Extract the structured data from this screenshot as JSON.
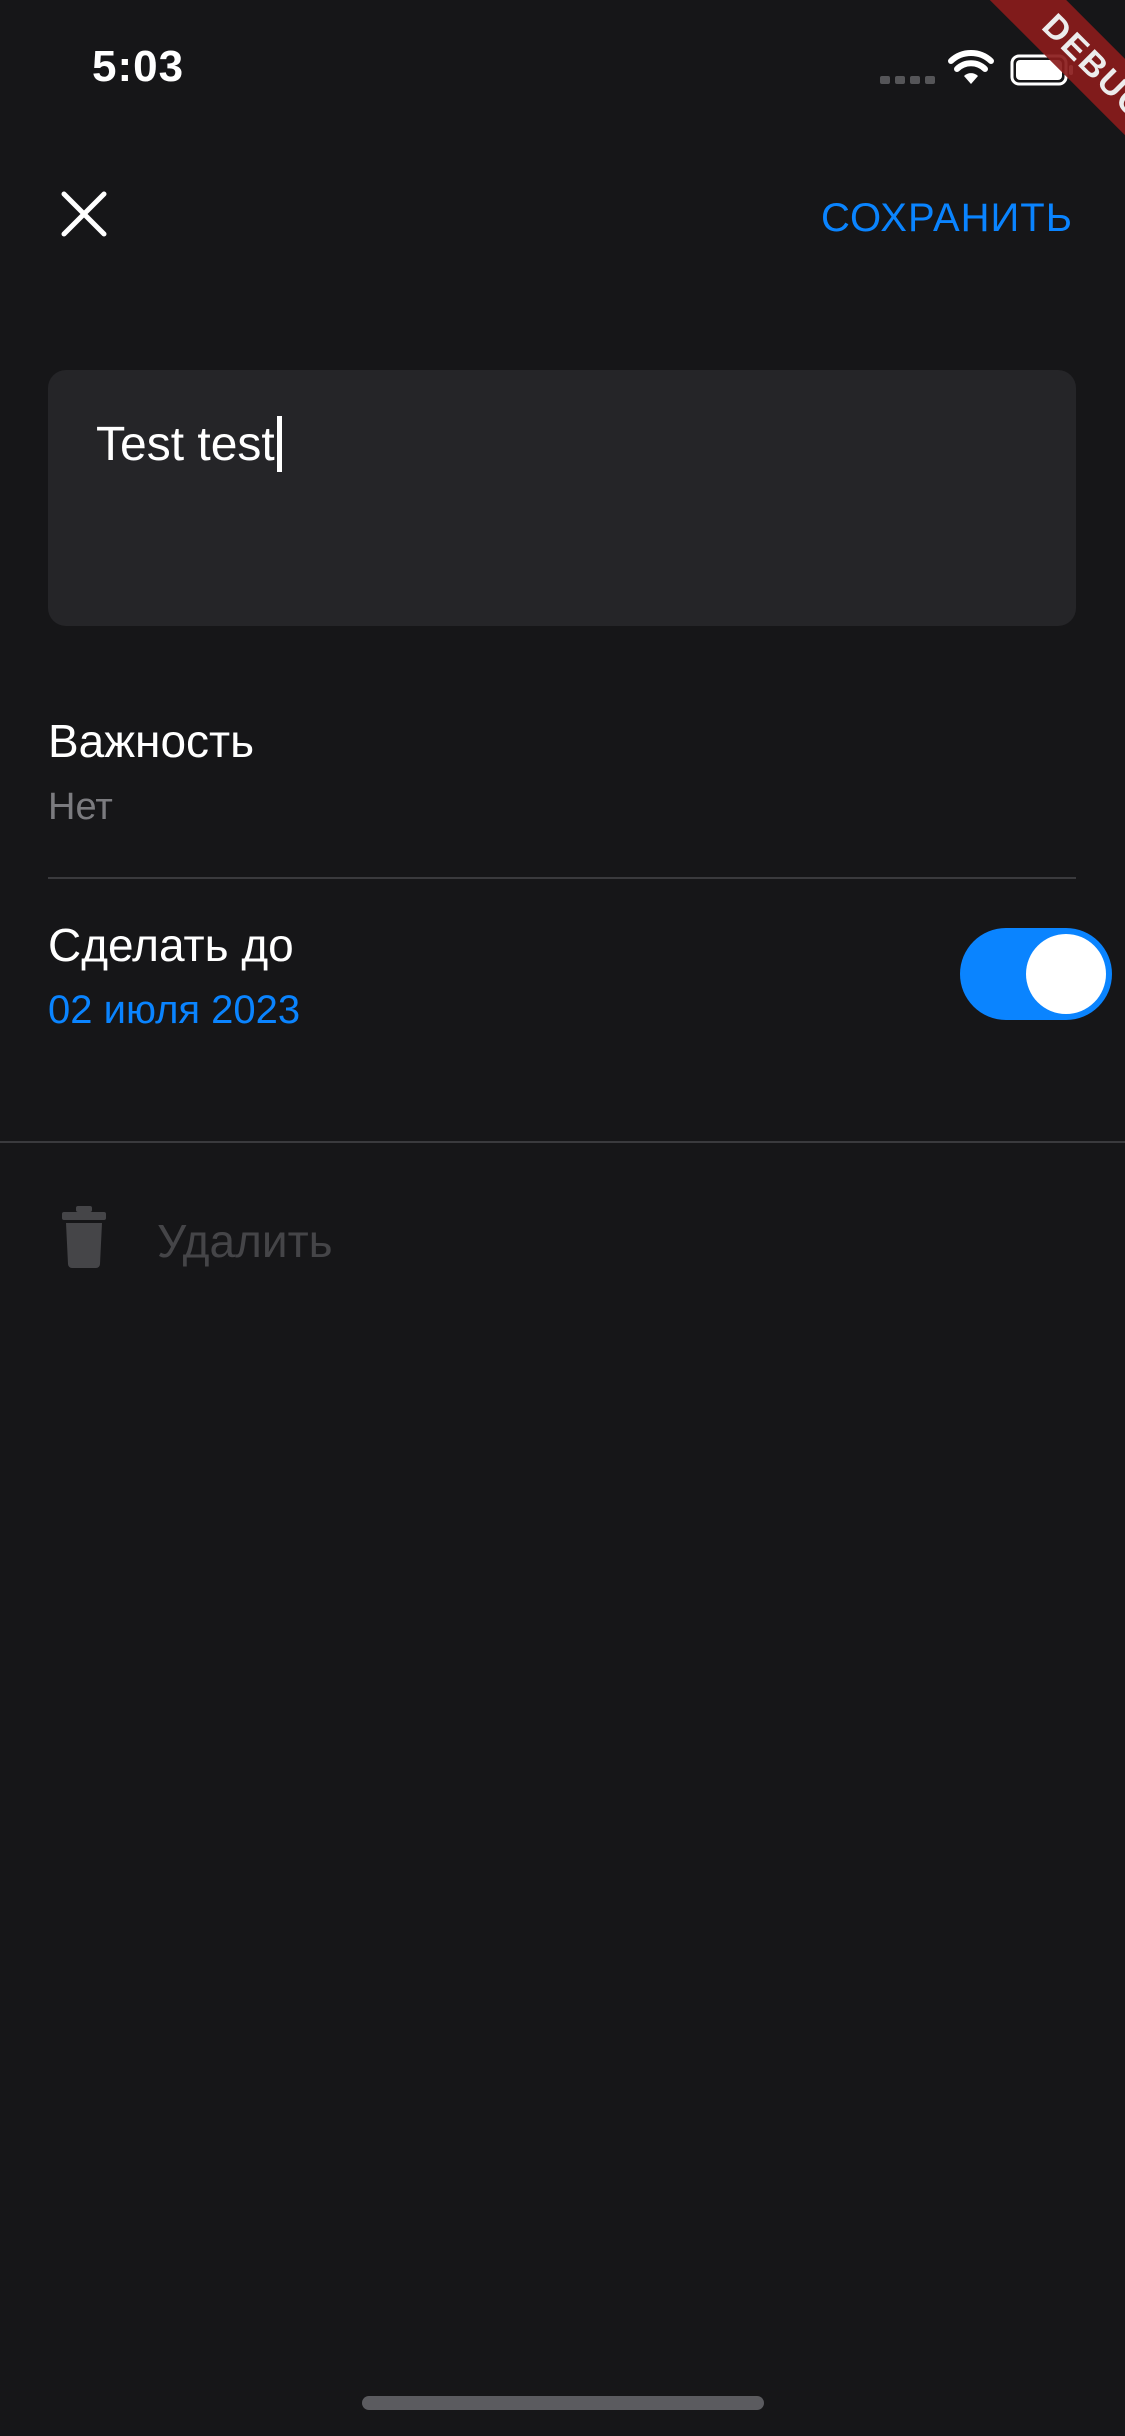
{
  "status_bar": {
    "time": "5:03"
  },
  "debug_banner": {
    "label": "DEBUG"
  },
  "header": {
    "close_icon": "close-icon",
    "save_label": "СОХРАНИТЬ"
  },
  "task": {
    "text": "Test test"
  },
  "importance": {
    "label": "Важность",
    "value": "Нет"
  },
  "deadline": {
    "label": "Сделать до",
    "date": "02 июля 2023",
    "toggle_on": true
  },
  "delete": {
    "icon": "trash-icon",
    "label": "Удалить"
  },
  "colors": {
    "background": "#161618",
    "accent": "#0a84ff",
    "field_background": "#252528",
    "secondary_text": "#7b7b7f",
    "disabled_text": "#454548"
  }
}
